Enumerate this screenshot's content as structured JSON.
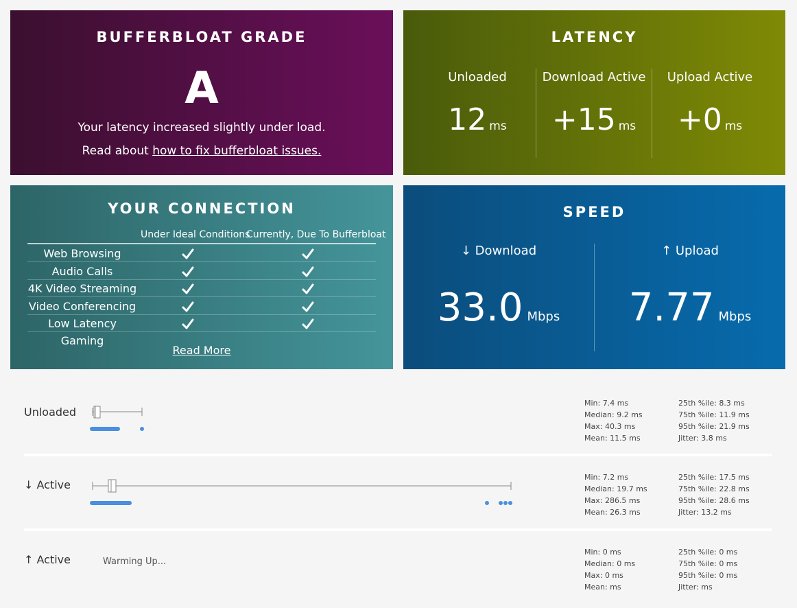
{
  "grade": {
    "title": "BUFFERBLOAT GRADE",
    "letter": "A",
    "description": "Your latency increased slightly under load.",
    "read_prefix": "Read about ",
    "link_text": "how to fix bufferbloat issues."
  },
  "latency": {
    "title": "LATENCY",
    "columns": [
      {
        "label": "Unloaded",
        "value": "12",
        "unit": "ms"
      },
      {
        "label": "Download Active",
        "value": "+15",
        "unit": "ms"
      },
      {
        "label": "Upload Active",
        "value": "+0",
        "unit": "ms"
      }
    ]
  },
  "connection": {
    "title": "YOUR CONNECTION",
    "headers": [
      "Under Ideal Conditions",
      "Currently, Due To Bufferbloat"
    ],
    "rows": [
      {
        "name": "Web Browsing",
        "ideal": true,
        "current": true
      },
      {
        "name": "Audio Calls",
        "ideal": true,
        "current": true
      },
      {
        "name": "4K Video Streaming",
        "ideal": true,
        "current": true
      },
      {
        "name": "Video Conferencing",
        "ideal": true,
        "current": true
      },
      {
        "name": "Low Latency Gaming",
        "ideal": true,
        "current": true
      }
    ],
    "read_more": "Read More"
  },
  "speed": {
    "title": "SPEED",
    "download": {
      "label": "↓ Download",
      "value": "33.0",
      "unit": "Mbps"
    },
    "upload": {
      "label": "↑ Upload",
      "value": "7.77",
      "unit": "Mbps"
    }
  },
  "sections": [
    {
      "label": "Unloaded",
      "left_stats": [
        "Min: 7.4 ms",
        "Median: 9.2 ms",
        "Max: 40.3 ms",
        "Mean: 11.5 ms"
      ],
      "right_stats": [
        "25th %ile: 8.3 ms",
        "75th %ile: 11.9 ms",
        "95th %ile: 21.9 ms",
        "Jitter: 3.8 ms"
      ]
    },
    {
      "label": "↓ Active",
      "left_stats": [
        "Min: 7.2 ms",
        "Median: 19.7 ms",
        "Max: 286.5 ms",
        "Mean: 26.3 ms"
      ],
      "right_stats": [
        "25th %ile: 17.5 ms",
        "75th %ile: 22.8 ms",
        "95th %ile: 28.6 ms",
        "Jitter: 13.2 ms"
      ]
    },
    {
      "label": "↑ Active",
      "status": "Warming Up...",
      "left_stats": [
        "Min: 0 ms",
        "Median: 0 ms",
        "Max: 0 ms",
        "Mean:  ms"
      ],
      "right_stats": [
        "25th %ile: 0 ms",
        "75th %ile: 0 ms",
        "95th %ile: 0 ms",
        "Jitter:  ms"
      ]
    }
  ],
  "colors": {
    "dot": "#4a8fe0",
    "box_stroke": "#888888"
  }
}
